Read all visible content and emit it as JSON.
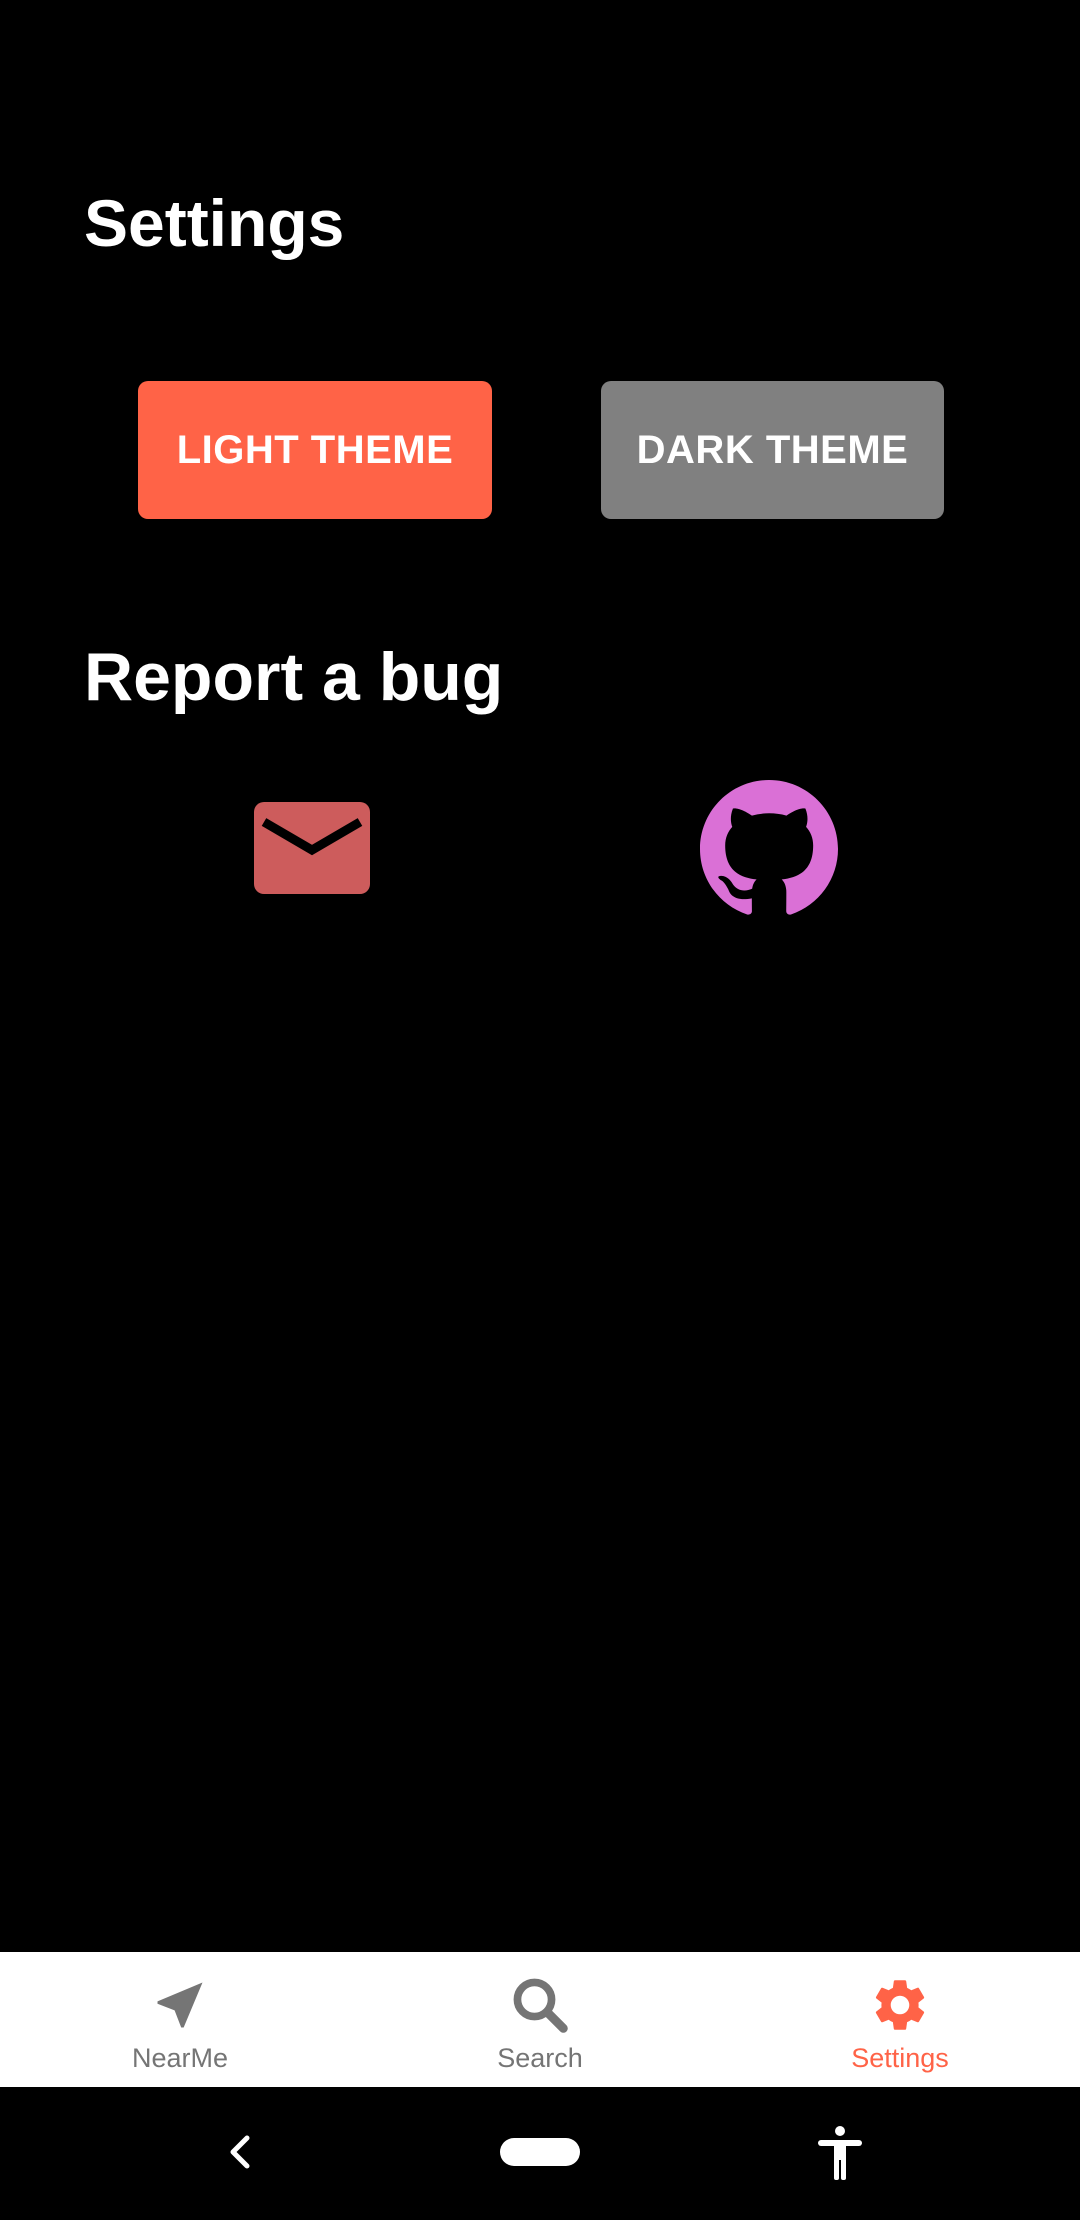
{
  "settings": {
    "title": "Settings",
    "light_theme_label": "LIGHT THEME",
    "dark_theme_label": "DARK THEME"
  },
  "report": {
    "title": "Report a bug",
    "mail_icon": "mail-icon",
    "github_icon": "github-icon"
  },
  "bottom_nav": {
    "items": [
      {
        "label": "NearMe",
        "icon": "navigation-arrow-icon",
        "active": false
      },
      {
        "label": "Search",
        "icon": "search-icon",
        "active": false
      },
      {
        "label": "Settings",
        "icon": "gear-icon",
        "active": true
      }
    ]
  },
  "colors": {
    "accent": "#ff6347",
    "light_button": "#ff6347",
    "dark_button": "#808080",
    "mail_icon": "#cd5c5c",
    "github_icon": "#da70d6",
    "inactive_nav": "#757575"
  }
}
